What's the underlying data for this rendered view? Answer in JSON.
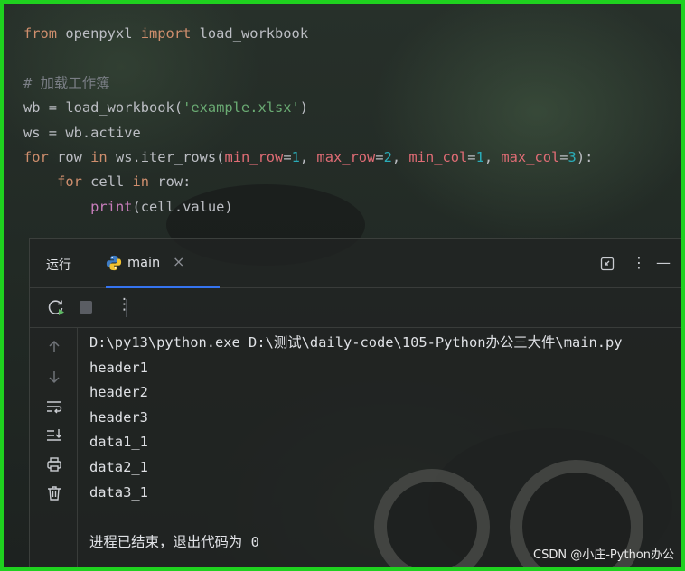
{
  "editor": {
    "lines": [
      [
        {
          "t": "from",
          "c": "kw"
        },
        {
          "t": " openpyxl ",
          "c": ""
        },
        {
          "t": "import",
          "c": "kw"
        },
        {
          "t": " load_workbook",
          "c": ""
        }
      ],
      [],
      [
        {
          "t": "# 加载工作簿",
          "c": "cmt"
        }
      ],
      [
        {
          "t": "wb = load_workbook(",
          "c": ""
        },
        {
          "t": "'example.xlsx'",
          "c": "str"
        },
        {
          "t": ")",
          "c": ""
        }
      ],
      [
        {
          "t": "ws = wb.active",
          "c": ""
        }
      ],
      [
        {
          "t": "for",
          "c": "kw"
        },
        {
          "t": " row ",
          "c": ""
        },
        {
          "t": "in",
          "c": "kw"
        },
        {
          "t": " ws.iter_rows(",
          "c": ""
        },
        {
          "t": "min_row",
          "c": "param"
        },
        {
          "t": "=",
          "c": ""
        },
        {
          "t": "1",
          "c": "num"
        },
        {
          "t": ", ",
          "c": ""
        },
        {
          "t": "max_row",
          "c": "param"
        },
        {
          "t": "=",
          "c": ""
        },
        {
          "t": "2",
          "c": "num"
        },
        {
          "t": ", ",
          "c": ""
        },
        {
          "t": "min_col",
          "c": "param"
        },
        {
          "t": "=",
          "c": ""
        },
        {
          "t": "1",
          "c": "num"
        },
        {
          "t": ", ",
          "c": ""
        },
        {
          "t": "max_col",
          "c": "param"
        },
        {
          "t": "=",
          "c": ""
        },
        {
          "t": "3",
          "c": "num"
        },
        {
          "t": "):",
          "c": ""
        }
      ],
      [
        {
          "t": "    ",
          "c": ""
        },
        {
          "t": "for",
          "c": "kw"
        },
        {
          "t": " cell ",
          "c": ""
        },
        {
          "t": "in",
          "c": "kw"
        },
        {
          "t": " row:",
          "c": ""
        }
      ],
      [
        {
          "t": "        ",
          "c": ""
        },
        {
          "t": "print",
          "c": "fn"
        },
        {
          "t": "(cell.value)",
          "c": ""
        }
      ]
    ]
  },
  "run_panel": {
    "title": "运行",
    "tab_label": "main",
    "tab_close": "×",
    "menu_glyph": "⋮",
    "minimize_glyph": "—",
    "console_lines": [
      "D:\\py13\\python.exe D:\\测试\\daily-code\\105-Python办公三大件\\main.py",
      "header1",
      "header2",
      "header3",
      "data1_1",
      "data2_1",
      "data3_1",
      "",
      "进程已结束，退出代码为 0"
    ]
  },
  "watermark": "CSDN @小庄-Python办公",
  "colors": {
    "accent": "#3574f0",
    "frame": "#1fd11f",
    "run": "#5fb865"
  }
}
